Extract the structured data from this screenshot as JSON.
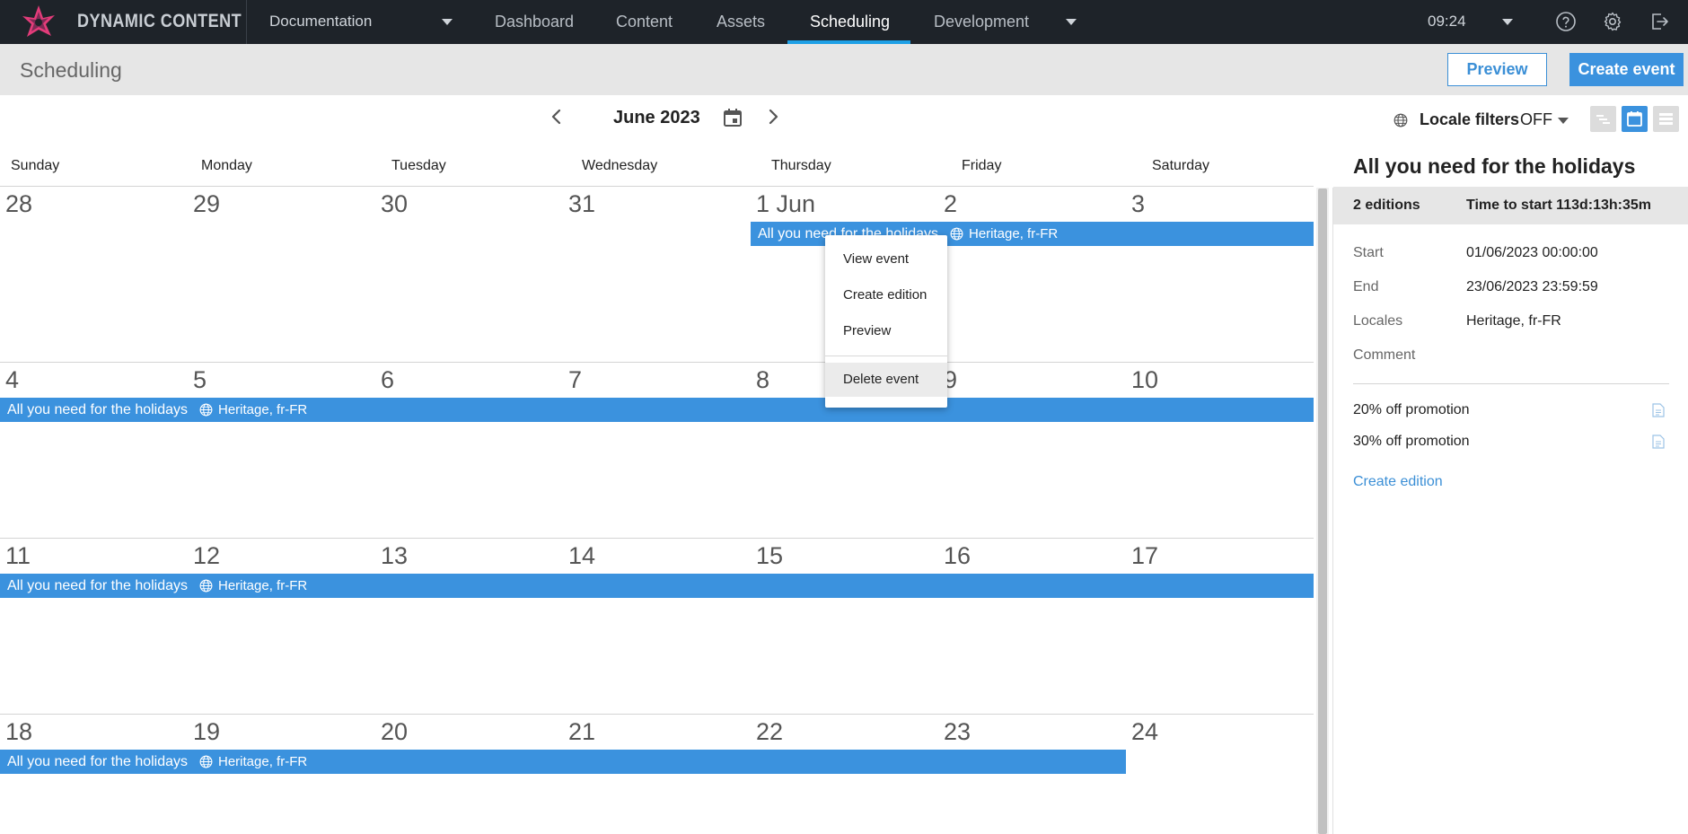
{
  "brand": "DYNAMIC CONTENT",
  "hub": "Documentation",
  "nav": {
    "tabs": [
      {
        "label": "Dashboard"
      },
      {
        "label": "Content"
      },
      {
        "label": "Assets"
      },
      {
        "label": "Scheduling"
      },
      {
        "label": "Development"
      }
    ],
    "active_tab": "Scheduling",
    "time": "09:24",
    "icons": [
      "help-icon",
      "settings-icon",
      "logout-icon"
    ]
  },
  "subheader": {
    "title": "Scheduling",
    "preview_label": "Preview",
    "create_event_label": "Create event"
  },
  "calendar": {
    "month": "June 2023",
    "locale_filters_label": "Locale filters",
    "locale_filters_value": "OFF",
    "days": [
      "Sunday",
      "Monday",
      "Tuesday",
      "Wednesday",
      "Thursday",
      "Friday",
      "Saturday"
    ],
    "weeks": [
      [
        "28",
        "29",
        "30",
        "31",
        "1 Jun",
        "2",
        "3"
      ],
      [
        "4",
        "5",
        "6",
        "7",
        "8",
        "9",
        "10"
      ],
      [
        "11",
        "12",
        "13",
        "14",
        "15",
        "16",
        "17"
      ],
      [
        "18",
        "19",
        "20",
        "21",
        "22",
        "23",
        "24"
      ]
    ],
    "event": {
      "title": "All you need for the holidays",
      "locales": "Heritage, fr-FR"
    },
    "accent_color": "#3b92de"
  },
  "context_menu": {
    "items": [
      "View event",
      "Create edition",
      "Preview",
      "Delete event"
    ],
    "hovered": "Delete event"
  },
  "panel": {
    "title": "All you need for the holidays",
    "editions_count": "2 editions",
    "time_to_start": "Time to start 113d:13h:35m",
    "props": [
      {
        "label": "Start",
        "value": "01/06/2023 00:00:00"
      },
      {
        "label": "End",
        "value": "23/06/2023 23:59:59"
      },
      {
        "label": "Locales",
        "value": "Heritage, fr-FR"
      },
      {
        "label": "Comment",
        "value": ""
      }
    ],
    "editions": [
      "20% off promotion",
      "30% off promotion"
    ],
    "create_edition_label": "Create edition"
  }
}
